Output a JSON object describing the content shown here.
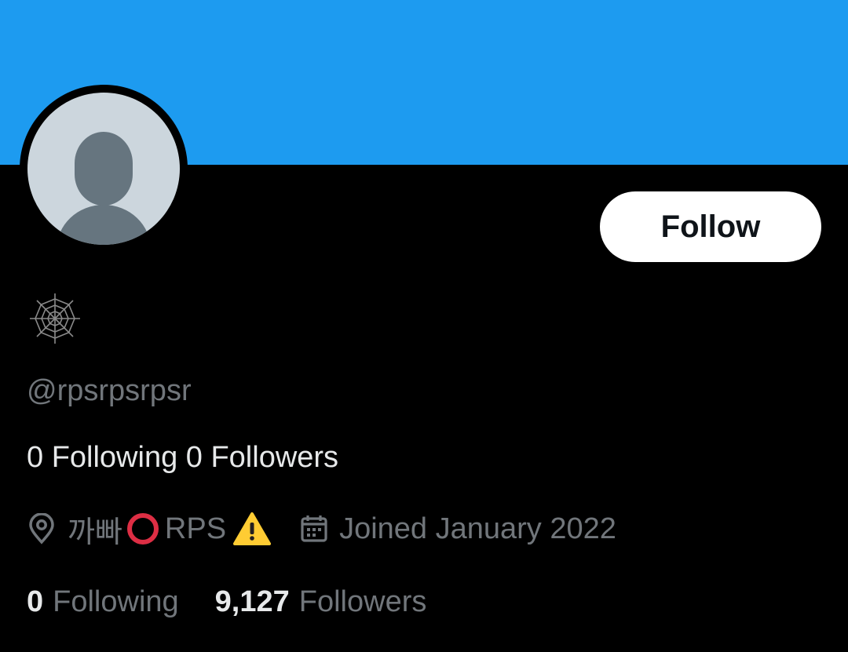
{
  "profile": {
    "banner_color": "#1D9BF0",
    "avatar": "default-avatar",
    "display_name_icon": "spider-web-icon",
    "handle": "@rpsrpsrpsr",
    "bio": "0 Following 0 Followers",
    "follow_button_label": "Follow",
    "location": {
      "icon": "location-pin-icon",
      "text": "까빠",
      "emoji_1": "hollow-red-circle",
      "text_2": "RPS",
      "emoji_2": "warning-icon"
    },
    "joined": {
      "icon": "calendar-icon",
      "text": "Joined January 2022"
    },
    "stats": {
      "following_count": "0",
      "following_label": "Following",
      "followers_count": "9,127",
      "followers_label": "Followers"
    }
  }
}
